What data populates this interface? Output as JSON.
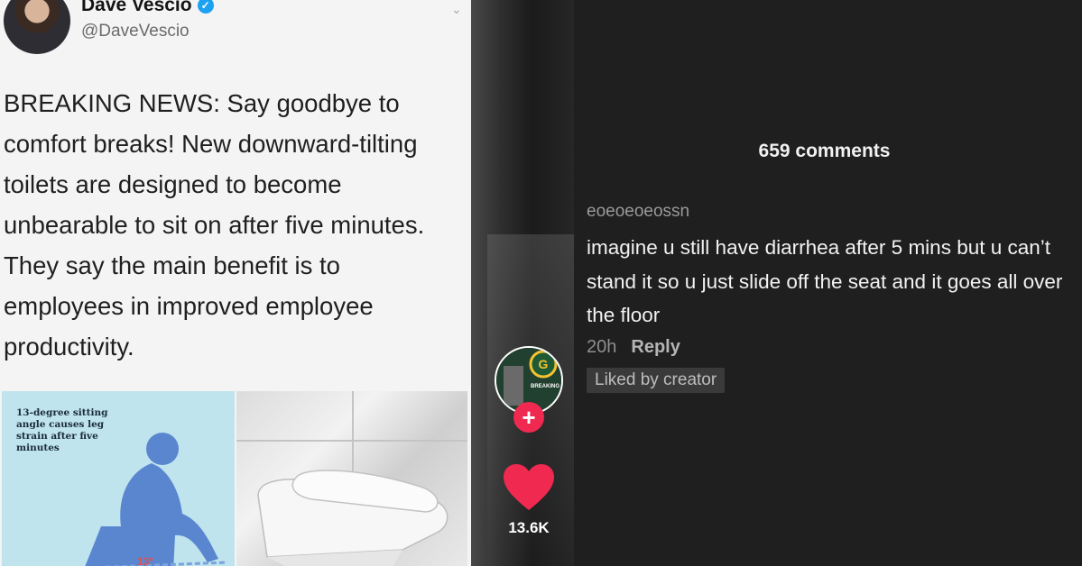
{
  "tweet": {
    "name": "Dave Vescio",
    "handle": "@DaveVescio",
    "text": "BREAKING NEWS: Say goodbye to comfort breaks! New downward-tilting toilets are designed to become unbearable to sit on after five minutes. They say the main benefit is to employees in improved employee productivity.",
    "infographic_text": "13-degree sitting angle causes leg strain after five minutes",
    "infographic_angle": "13°"
  },
  "video": {
    "profile_badge_text": "BREAKING",
    "like_count": "13.6K"
  },
  "comments": {
    "count_label": "659 comments",
    "items": [
      {
        "username": "eoeoeoeossn",
        "text": "imagine u still have diarrhea after 5 mins but u can’t stand it so u just slide off the seat and it goes all over the floor",
        "time": "20h",
        "reply_label": "Reply",
        "badge": "Liked by creator"
      }
    ]
  },
  "colors": {
    "accent_pink": "#ef2950",
    "verified_blue": "#1da1f2",
    "panel_bg": "#1f1f1f"
  }
}
